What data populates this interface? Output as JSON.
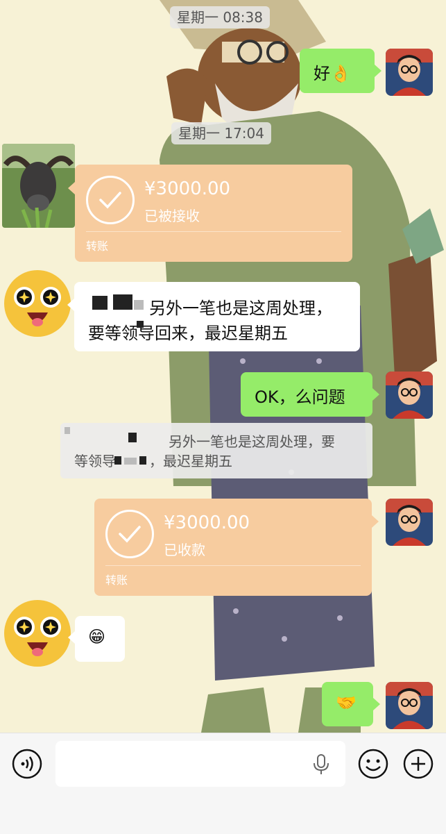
{
  "chat": {
    "timestamps": [
      "星期一 08:38",
      "星期一 17:04"
    ],
    "messages": {
      "ok_reply": "好👌",
      "transfer_1": {
        "amount": "¥3000.00",
        "status": "已被接收",
        "label": "转账"
      },
      "text_1_line1": "另外一笔也是这周处理，",
      "text_1_line2": "要等领导回来，最迟星期五",
      "ok_no_problem": "OK，么问题",
      "quote_line1": "另外一笔也是这周处理，要",
      "quote_line2": "等领导",
      "quote_line2b": "，最迟星期五",
      "transfer_2": {
        "amount": "¥3000.00",
        "status": "已收款",
        "label": "转账"
      },
      "grin_emoji": "😁",
      "handshake_emoji": "🤝"
    }
  },
  "input_bar": {
    "voice_icon": "voice-icon",
    "mic_icon": "microphone-icon",
    "emoji_icon": "emoji-icon",
    "plus_icon": "plus-icon"
  },
  "colors": {
    "green_bubble": "#95ec69",
    "transfer_orange": "#f7cc9f",
    "wallpaper": "#f7f2d6"
  }
}
